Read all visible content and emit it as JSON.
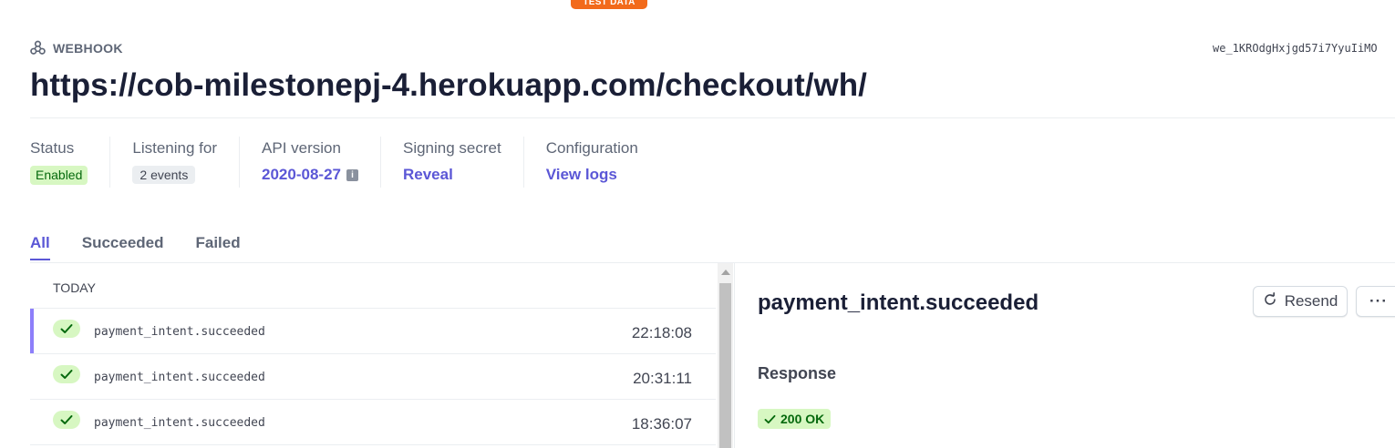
{
  "banner": {
    "label": "TEST DATA"
  },
  "header": {
    "type_label": "WEBHOOK",
    "endpoint_id": "we_1KROdgHxjgd57i7YyuIiMO",
    "url": "https://cob-milestonepj-4.herokuapp.com/checkout/wh/"
  },
  "meta": {
    "status": {
      "label": "Status",
      "value": "Enabled"
    },
    "listening": {
      "label": "Listening for",
      "value": "2 events"
    },
    "api_version": {
      "label": "API version",
      "value": "2020-08-27"
    },
    "signing_secret": {
      "label": "Signing secret",
      "value": "Reveal"
    },
    "configuration": {
      "label": "Configuration",
      "value": "View logs"
    }
  },
  "tabs": [
    {
      "label": "All",
      "active": true
    },
    {
      "label": "Succeeded",
      "active": false
    },
    {
      "label": "Failed",
      "active": false
    }
  ],
  "events": {
    "group_label": "TODAY",
    "rows": [
      {
        "name": "payment_intent.succeeded",
        "time": "22:18:08",
        "selected": true
      },
      {
        "name": "payment_intent.succeeded",
        "time": "20:31:11",
        "selected": false
      },
      {
        "name": "payment_intent.succeeded",
        "time": "18:36:07",
        "selected": false
      }
    ]
  },
  "detail": {
    "title": "payment_intent.succeeded",
    "resend_label": "Resend",
    "more_label": "···",
    "response_label": "Response",
    "response_status": "200 OK"
  },
  "colors": {
    "accent": "#5b57d6",
    "success_bg": "#d7f7c2",
    "success_text": "#05690d",
    "test_badge": "#f26a1b",
    "selected_bar": "#8d7ffa"
  },
  "icons": {
    "webhook": "webhook-icon",
    "info": "info-icon",
    "check": "check-icon",
    "resend": "refresh-icon",
    "more": "more-icon"
  }
}
